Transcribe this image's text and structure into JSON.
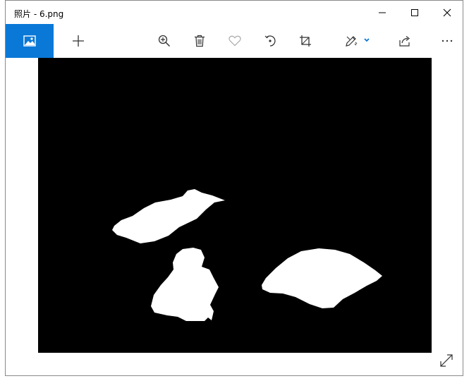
{
  "window": {
    "title": "照片 - 6.png"
  },
  "titlebar": {
    "minimize": "minimize-icon",
    "maximize": "maximize-icon",
    "close": "close-icon"
  },
  "toolbar": {
    "app_icon": "image-icon",
    "items": [
      "add-icon",
      "zoom-in-icon",
      "delete-icon",
      "favorite-heart-icon",
      "rotate-icon",
      "crop-icon",
      "edit-draw-icon",
      "share-icon",
      "more-icon"
    ],
    "accent_color": "#0a78d7"
  },
  "image": {
    "background": "#000000",
    "shape_color": "#ffffff"
  }
}
